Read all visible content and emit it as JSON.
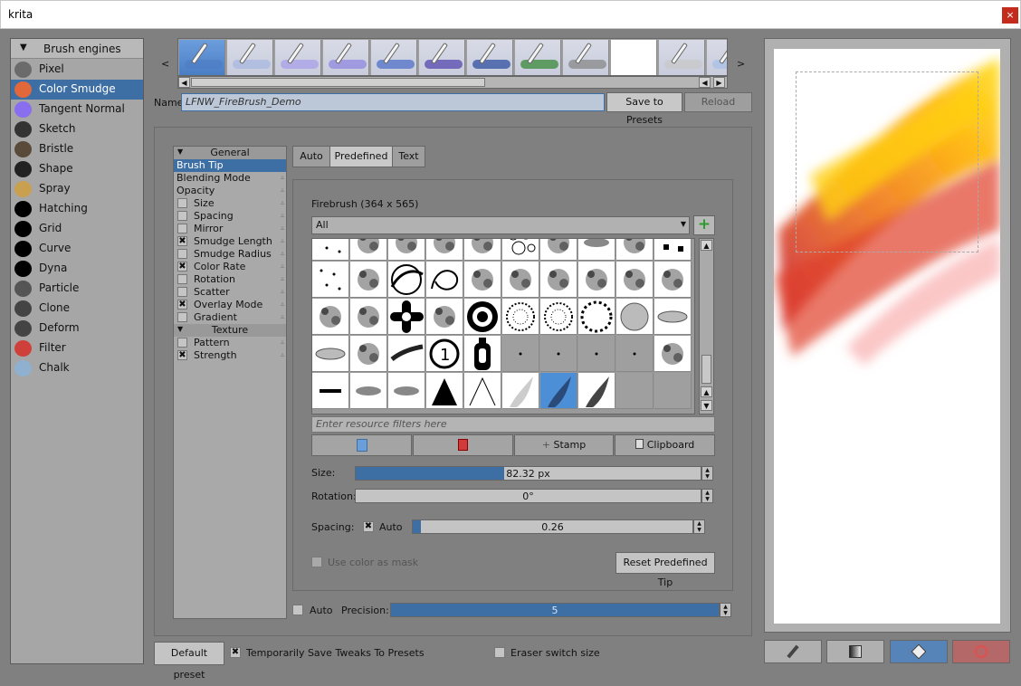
{
  "window": {
    "title": "krita",
    "close_glyph": "×"
  },
  "engines": {
    "header": "Brush engines",
    "items": [
      {
        "label": "Pixel",
        "icon": "pixel-brush-icon",
        "color": "#6b6b6b"
      },
      {
        "label": "Color Smudge",
        "icon": "color-smudge-icon",
        "color": "#e0683a",
        "selected": true
      },
      {
        "label": "Tangent Normal",
        "icon": "tangent-normal-icon",
        "color": "#8a6ef0"
      },
      {
        "label": "Sketch",
        "icon": "sketch-icon",
        "color": "#333333"
      },
      {
        "label": "Bristle",
        "icon": "bristle-icon",
        "color": "#5a4a3a"
      },
      {
        "label": "Shape",
        "icon": "shape-icon",
        "color": "#222222"
      },
      {
        "label": "Spray",
        "icon": "spray-icon",
        "color": "#c8a050"
      },
      {
        "label": "Hatching",
        "icon": "hatching-icon",
        "color": "#000000"
      },
      {
        "label": "Grid",
        "icon": "grid-icon",
        "color": "#000000"
      },
      {
        "label": "Curve",
        "icon": "curve-icon",
        "color": "#000000"
      },
      {
        "label": "Dyna",
        "icon": "dyna-icon",
        "color": "#000000"
      },
      {
        "label": "Particle",
        "icon": "particle-icon",
        "color": "#555555"
      },
      {
        "label": "Clone",
        "icon": "clone-icon",
        "color": "#444444"
      },
      {
        "label": "Deform",
        "icon": "deform-icon",
        "color": "#444444"
      },
      {
        "label": "Filter",
        "icon": "filter-icon",
        "color": "#d0403a"
      },
      {
        "label": "Chalk",
        "icon": "chalk-icon",
        "color": "#90b0d0"
      }
    ]
  },
  "preset_strip": {
    "scroll_left": "<",
    "scroll_right": ">",
    "presets": [
      {
        "icon": "blue-soft-brush-preset-icon",
        "color": "#4f7fc6",
        "selected": true
      },
      {
        "icon": "light-blue-brush-preset-icon",
        "color": "#a8b8e0"
      },
      {
        "icon": "lavender-brush-preset-icon",
        "color": "#a8a0e8"
      },
      {
        "icon": "violet-brush-preset-icon",
        "color": "#9088e0"
      },
      {
        "icon": "blue-ink-pen-preset-icon",
        "color": "#5070c8"
      },
      {
        "icon": "indigo-pen-preset-icon",
        "color": "#5548b0"
      },
      {
        "icon": "navy-marker-preset-icon",
        "color": "#3050a0"
      },
      {
        "icon": "green-brush-preset-icon",
        "color": "#3a8a3a"
      },
      {
        "icon": "eraser-preset-icon",
        "color": "#888888"
      },
      {
        "icon": "blank-preset-icon",
        "color": "#ffffff",
        "blank": true
      },
      {
        "icon": "pencil-preset-icon",
        "color": "#c8c8c8"
      },
      {
        "icon": "light-blue-preset-icon",
        "color": "#a8c0e8"
      }
    ]
  },
  "name_row": {
    "label": "Name:",
    "value": "LFNW_FireBrush_Demo",
    "save_button": "Save to Presets",
    "reload_button": "Reload"
  },
  "options": {
    "groups": [
      {
        "header": "General",
        "items": [
          {
            "label": "Brush Tip",
            "selected": true
          },
          {
            "label": "Blending Mode"
          },
          {
            "label": "Opacity"
          },
          {
            "label": "Size",
            "checkbox": true,
            "checked": false
          },
          {
            "label": "Spacing",
            "checkbox": true,
            "checked": false
          },
          {
            "label": "Mirror",
            "checkbox": true,
            "checked": false
          },
          {
            "label": "Smudge Length",
            "checkbox": true,
            "checked": true
          },
          {
            "label": "Smudge Radius",
            "checkbox": true,
            "checked": false
          },
          {
            "label": "Color Rate",
            "checkbox": true,
            "checked": true
          },
          {
            "label": "Rotation",
            "checkbox": true,
            "checked": false
          },
          {
            "label": "Scatter",
            "checkbox": true,
            "checked": false
          },
          {
            "label": "Overlay Mode",
            "checkbox": true,
            "checked": true
          },
          {
            "label": "Gradient",
            "checkbox": true,
            "checked": false
          }
        ]
      },
      {
        "header": "Texture",
        "items": [
          {
            "label": "Pattern",
            "checkbox": true,
            "checked": false
          },
          {
            "label": "Strength",
            "checkbox": true,
            "checked": true
          }
        ]
      }
    ],
    "check_glyph": "✖"
  },
  "tabs": [
    {
      "label": "Auto"
    },
    {
      "label": "Predefined",
      "active": true
    },
    {
      "label": "Text"
    }
  ],
  "tip": {
    "title": "Firebrush (364 x 565)",
    "tag_filter": "All",
    "filter_placeholder": "Enter resource filters here",
    "stamp_button": "Stamp",
    "clipboard_button": "Clipboard",
    "size_label": "Size:",
    "size_value": "82.32 px",
    "size_fraction": 0.43,
    "rotation_label": "Rotation:",
    "rotation_value": "0°",
    "spacing_label": "Spacing:",
    "spacing_auto_label": "Auto",
    "spacing_auto_checked": true,
    "spacing_value": "0.26",
    "spacing_fraction": 0.03,
    "use_color_mask_label": "Use color as mask",
    "reset_button": "Reset Predefined Tip",
    "auto_label": "Auto",
    "precision_label": "Precision:",
    "precision_value": "5",
    "precision_fraction": 1.0
  },
  "brush_grid": [
    "dots",
    "blot",
    "splatter",
    "scratch",
    "scratch",
    "bubbles",
    "specks",
    "smear",
    "specks",
    "checker",
    "dots",
    "blot",
    "rings",
    "scribble",
    "scratch",
    "specks",
    "specks",
    "specks",
    "splatter",
    "blot",
    "blot",
    "sketch",
    "cross",
    "splatter",
    "target",
    "dashed-circle",
    "dashed-circle",
    "ring-dots",
    "disc",
    "ellipse",
    "ellipse",
    "blot",
    "stroke",
    "one",
    "bottle",
    "grey-dot",
    "grey-dot",
    "grey-dot",
    "grey-dot",
    "specks",
    "speck",
    "smear",
    "smear",
    "triangle",
    "wedge",
    "flame-light",
    "flame-blue",
    "flame-dark",
    "grey",
    "grey"
  ],
  "bottom": {
    "default_preset_button": "Default preset",
    "save_tweaks_label": "Temporarily Save Tweaks To Presets",
    "save_tweaks_checked": true,
    "eraser_switch_label": "Eraser switch size",
    "eraser_switch_checked": false
  },
  "scratchpad_buttons": [
    {
      "icon": "brush-icon"
    },
    {
      "icon": "gradient-fill-icon"
    },
    {
      "icon": "paint-bucket-icon"
    },
    {
      "icon": "clear-icon"
    }
  ]
}
